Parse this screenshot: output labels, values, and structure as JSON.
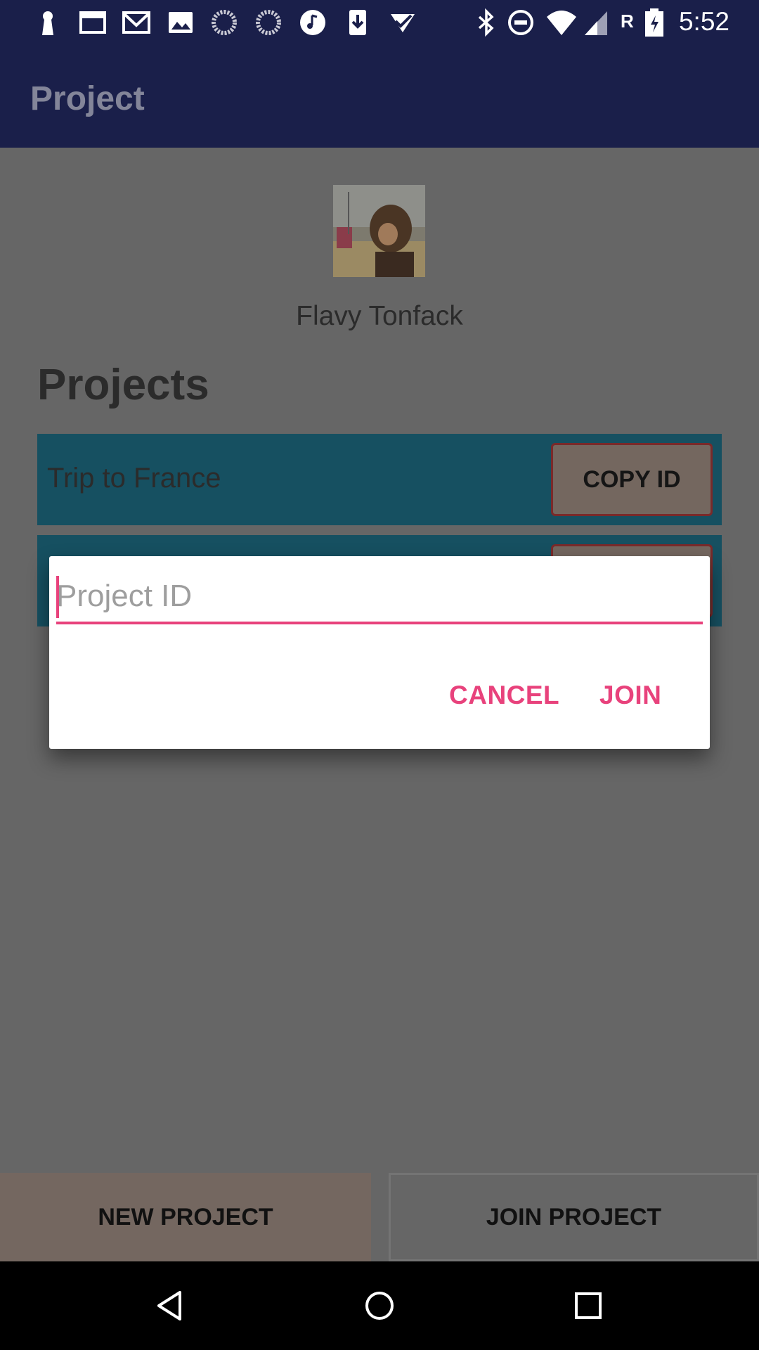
{
  "status_bar": {
    "time": "5:52",
    "roaming_indicator": "R",
    "left_icons": [
      "keyhole-icon",
      "window-icon",
      "gmail-icon",
      "image-icon",
      "sync-icon",
      "sync-icon",
      "music-icon",
      "download-icon",
      "check-icon"
    ],
    "right_icons": [
      "bluetooth-icon",
      "do-not-disturb-icon",
      "wifi-icon",
      "signal-icon",
      "battery-icon"
    ]
  },
  "app_bar": {
    "title": "Project"
  },
  "profile": {
    "name": "Flavy Tonfack"
  },
  "projects": {
    "heading": "Projects",
    "items": [
      {
        "name": "Trip to France",
        "copy_label": "COPY ID"
      },
      {
        "name": "",
        "copy_label": ""
      }
    ]
  },
  "bottom_actions": {
    "new_label": "NEW PROJECT",
    "join_label": "JOIN PROJECT"
  },
  "dialog": {
    "input_placeholder": "Project ID",
    "input_value": "",
    "cancel_label": "CANCEL",
    "join_label": "JOIN"
  },
  "colors": {
    "primary_dark": "#1a1f4a",
    "accent": "#e8427c",
    "project_row": "#165061",
    "scrim": "#666666"
  },
  "nav_bar": {
    "icons": [
      "back-icon",
      "home-icon",
      "recents-icon"
    ]
  }
}
